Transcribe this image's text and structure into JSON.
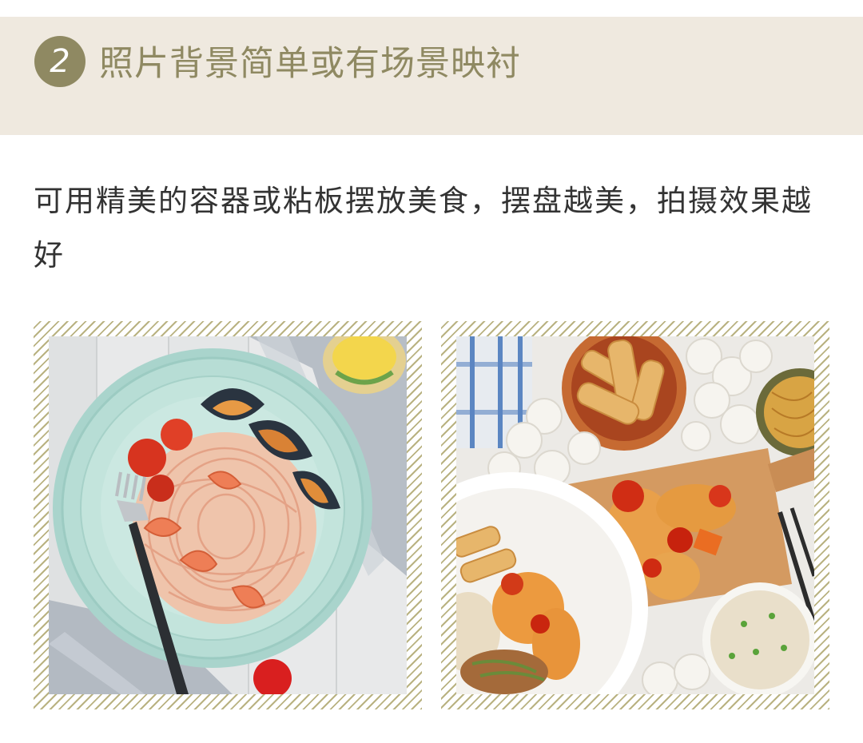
{
  "step": {
    "number": "2",
    "title": "照片背景简单或有场景映衬"
  },
  "description": "可用精美的容器或粘板摆放美食，摆盘越美，拍摄效果越好",
  "colors": {
    "accent": "#8f8962",
    "banner_bg": "#efe9df",
    "text": "#333333",
    "frame_stripe": "#b9b281"
  },
  "photos": [
    {
      "name": "pasta-seafood-photo"
    },
    {
      "name": "chinese-dishes-photo"
    }
  ]
}
